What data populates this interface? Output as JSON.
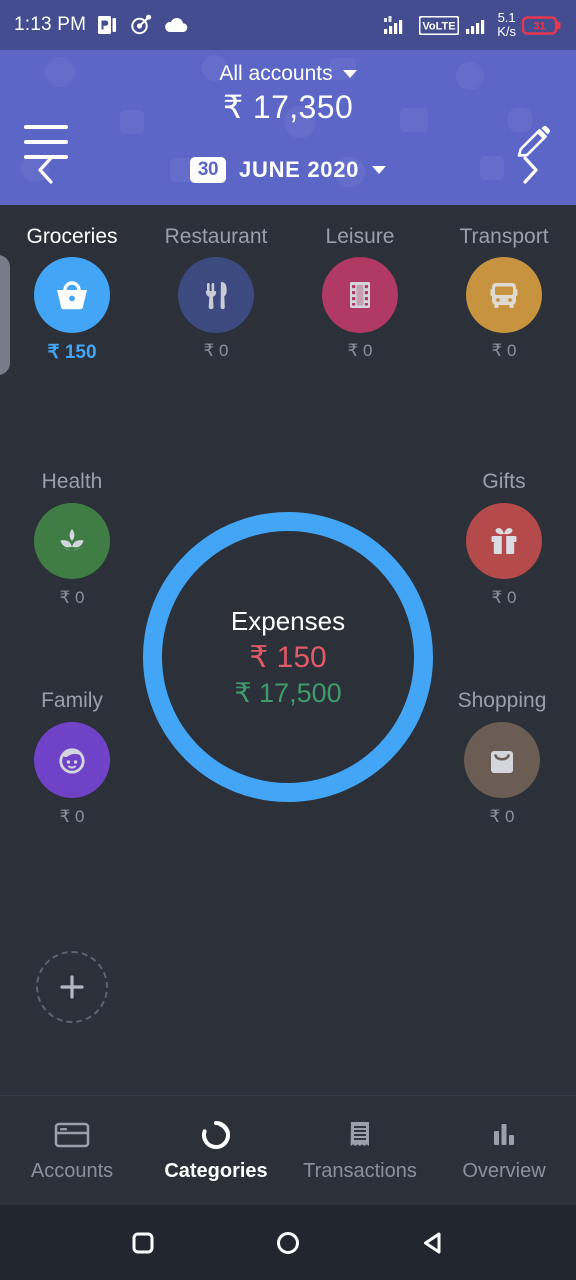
{
  "statusbar": {
    "time": "1:13 PM",
    "left_icons": [
      "powerpoint-icon",
      "target-icon",
      "cloud-icon"
    ],
    "right_icons": [
      "signal-1-icon",
      "volte-icon",
      "signal-2-icon"
    ],
    "volte_label": "VoLTE",
    "data_rate_value": "5.1",
    "data_rate_unit": "K/s",
    "battery_label": "31",
    "battery_color": "#e8384f"
  },
  "appbar": {
    "menu_icon": "hamburger-menu-icon",
    "edit_icon": "pencil-edit-icon",
    "account_label": "All accounts",
    "account_caret": "chevron-down-icon",
    "balance": "₹ 17,350",
    "bg_color": "#5b66c7",
    "date": {
      "prev_icon": "chevron-left-icon",
      "next_icon": "chevron-right-icon",
      "day": "30",
      "month_year": "JUNE 2020",
      "caret": "chevron-down-icon"
    }
  },
  "top_categories": [
    {
      "label": "Groceries",
      "amount": "₹ 150",
      "color": "#42a5f5",
      "icon": "shopping-basket-icon",
      "active": true
    },
    {
      "label": "Restaurant",
      "amount": "₹ 0",
      "color": "#3c4a80",
      "icon": "fork-knife-icon",
      "active": false
    },
    {
      "label": "Leisure",
      "amount": "₹ 0",
      "color": "#b03a63",
      "icon": "film-strip-icon",
      "active": false
    },
    {
      "label": "Transport",
      "amount": "₹ 0",
      "color": "#c8933f",
      "icon": "bus-icon",
      "active": false
    }
  ],
  "side_categories": {
    "health": {
      "label": "Health",
      "amount": "₹ 0",
      "color": "#3f7d45",
      "icon": "leaf-spa-icon"
    },
    "gifts": {
      "label": "Gifts",
      "amount": "₹ 0",
      "color": "#b44a4a",
      "icon": "gift-box-icon"
    },
    "family": {
      "label": "Family",
      "amount": "₹ 0",
      "color": "#6f42c8",
      "icon": "child-face-icon"
    },
    "shopping": {
      "label": "Shopping",
      "amount": "₹ 0",
      "color": "#6b5c54",
      "icon": "shopping-bag-icon"
    }
  },
  "donut": {
    "title": "Expenses",
    "expense": "₹ 150",
    "income": "₹ 17,500",
    "ring_color": "#42a5f5",
    "expense_color": "#e05a68",
    "income_color": "#3f9c6a"
  },
  "add_button": {
    "icon": "plus-icon"
  },
  "bottom_nav": [
    {
      "label": "Accounts",
      "icon": "credit-card-icon",
      "active": false
    },
    {
      "label": "Categories",
      "icon": "donut-chart-icon",
      "active": true
    },
    {
      "label": "Transactions",
      "icon": "receipt-icon",
      "active": false
    },
    {
      "label": "Overview",
      "icon": "bar-chart-icon",
      "active": false
    }
  ],
  "android_nav": [
    {
      "icon": "recents-square-icon"
    },
    {
      "icon": "home-circle-icon"
    },
    {
      "icon": "back-triangle-icon"
    }
  ]
}
